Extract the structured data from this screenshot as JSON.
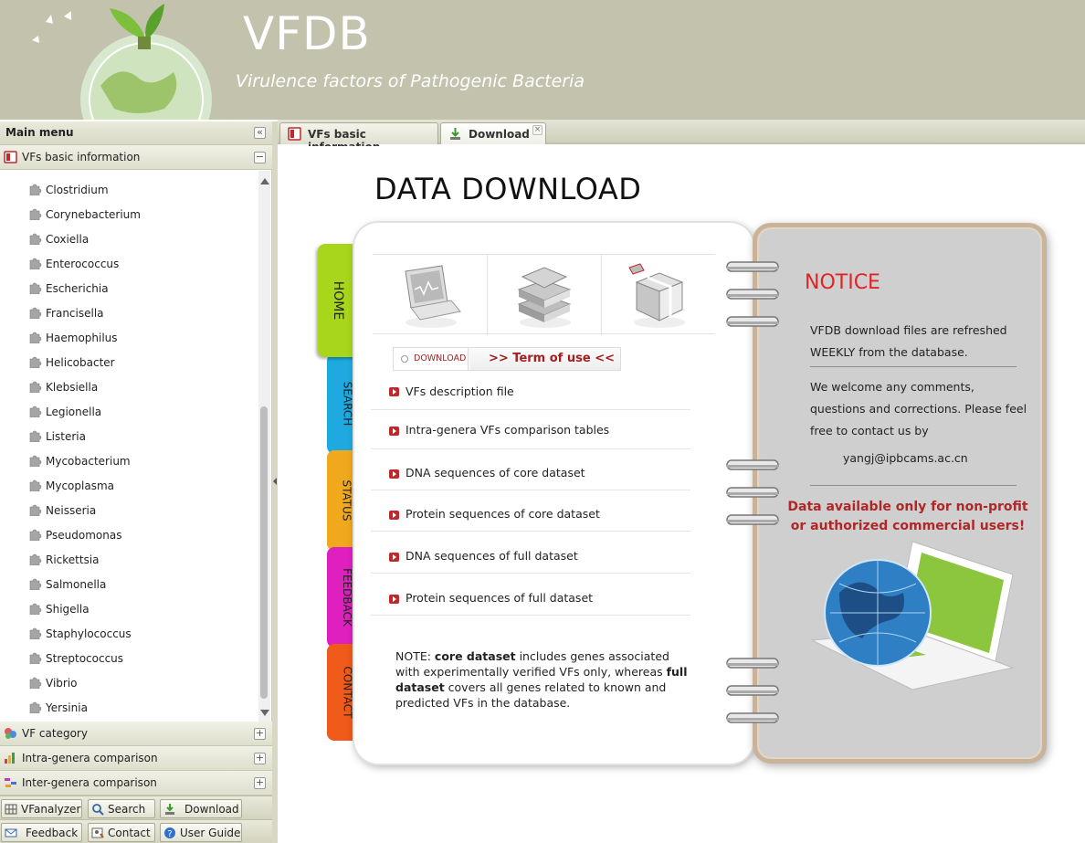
{
  "header": {
    "title": "VFDB",
    "subtitle": "Virulence factors of Pathogenic Bacteria"
  },
  "sidebar": {
    "title": "Main menu",
    "sections": [
      {
        "label": "VFs basic information",
        "state": "expanded"
      },
      {
        "label": "VF category",
        "state": "collapsed"
      },
      {
        "label": "Intra-genera comparison",
        "state": "collapsed"
      },
      {
        "label": "Inter-genera comparison",
        "state": "collapsed"
      }
    ],
    "genera": [
      "Clostridium",
      "Corynebacterium",
      "Coxiella",
      "Enterococcus",
      "Escherichia",
      "Francisella",
      "Haemophilus",
      "Helicobacter",
      "Klebsiella",
      "Legionella",
      "Listeria",
      "Mycobacterium",
      "Mycoplasma",
      "Neisseria",
      "Pseudomonas",
      "Rickettsia",
      "Salmonella",
      "Shigella",
      "Staphylococcus",
      "Streptococcus",
      "Vibrio",
      "Yersinia"
    ],
    "toolbar_row1": [
      "VFanalyzer",
      "Search",
      "Download"
    ],
    "toolbar_row2": [
      "Feedback",
      "Contact",
      "User Guide"
    ]
  },
  "tabs": [
    {
      "label": "VFs basic information",
      "active": false
    },
    {
      "label": "Download",
      "active": true
    }
  ],
  "main": {
    "page_title": "DATA DOWNLOAD",
    "side_tabs": [
      {
        "label": "HOME",
        "color": "#a8d61a"
      },
      {
        "label": "SEARCH",
        "color": "#1eaae0"
      },
      {
        "label": "STATUS",
        "color": "#f0a81c"
      },
      {
        "label": "FEEDBACK",
        "color": "#e01fbf"
      },
      {
        "label": "CONTACT",
        "color": "#f05a1a"
      }
    ],
    "download_tab": "DOWNLOAD",
    "terms_tab": ">> Term of use <<",
    "links": [
      "VFs description file",
      "Intra-genera VFs comparison tables",
      "DNA sequences of core dataset",
      "Protein sequences of core dataset",
      "DNA sequences of full dataset",
      "Protein sequences of full dataset"
    ],
    "note": {
      "prefix": "NOTE: ",
      "core_term": "core dataset",
      "middle": " includes genes associated with experimentally verified VFs only, whereas ",
      "full_term": "full dataset",
      "suffix": " covers all genes related to known and predicted VFs in the database."
    }
  },
  "notice": {
    "title": "NOTICE",
    "p1": "VFDB download files are refreshed WEEKLY from the database.",
    "p2": "We welcome any comments, questions and corrections. Please feel free to contact us by",
    "email": "yangj@ipbcams.ac.cn",
    "warning": "Data available only for non-profit or authorized commercial users!"
  },
  "colors": {
    "header_bg": "#c2c2ad",
    "accent_red": "#c0282b",
    "notice_red": "#e02424"
  }
}
